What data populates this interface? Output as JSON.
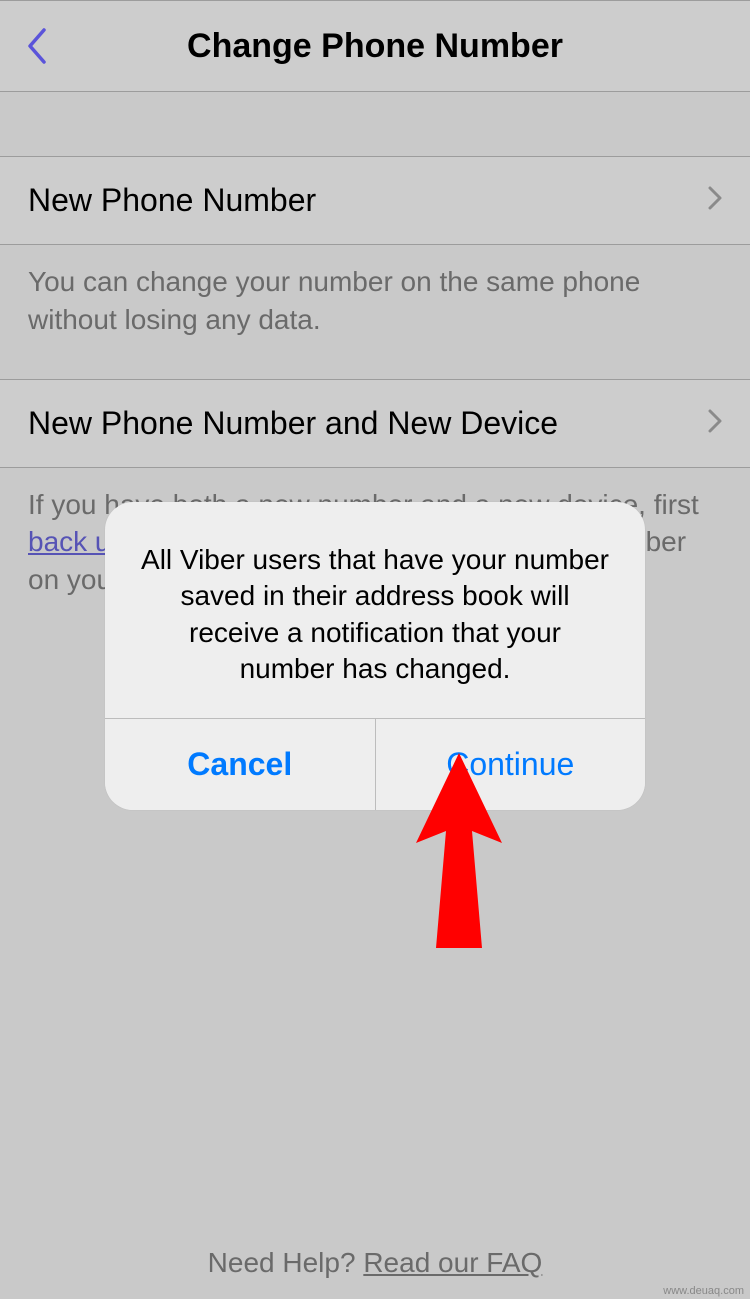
{
  "nav": {
    "title": "Change Phone Number"
  },
  "rows": {
    "new_phone": {
      "label": "New Phone Number"
    },
    "new_phone_device": {
      "label": "New Phone Number and New Device"
    }
  },
  "info": {
    "new_phone_desc": "You can change your number on the same phone without losing any data.",
    "device_desc_pre": "If you have both a new number and a new device, first ",
    "device_desc_link": "back u",
    "device_desc_mid": "mber on you"
  },
  "alert": {
    "message": "All Viber users that have your number saved in their address book will receive a notification that your number has changed.",
    "cancel": "Cancel",
    "continue": "Continue"
  },
  "footer": {
    "prefix": "Need Help? ",
    "link": "Read our FAQ"
  },
  "watermark": "www.deuaq.com"
}
